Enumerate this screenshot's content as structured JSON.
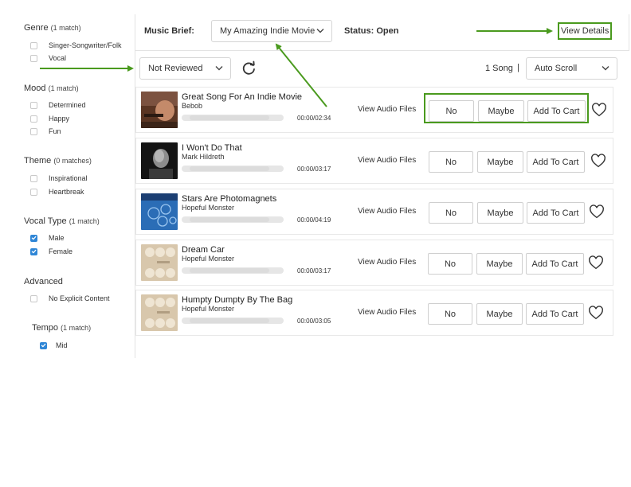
{
  "sidebar": {
    "sections": [
      {
        "title": "Genre",
        "count": "(1 match)",
        "options": [
          {
            "label": "Singer-Songwriter/Folk",
            "checked": false
          },
          {
            "label": "Vocal",
            "checked": false
          }
        ]
      },
      {
        "title": "Mood",
        "count": "(1 match)",
        "options": [
          {
            "label": "Determined",
            "checked": false
          },
          {
            "label": "Happy",
            "checked": false
          },
          {
            "label": "Fun",
            "checked": false
          }
        ]
      },
      {
        "title": "Theme",
        "count": "(0 matches)",
        "options": [
          {
            "label": "Inspirational",
            "checked": false
          },
          {
            "label": "Heartbreak",
            "checked": false
          }
        ]
      },
      {
        "title": "Vocal Type",
        "count": "(1 match)",
        "options": [
          {
            "label": "Male",
            "checked": true
          },
          {
            "label": "Female",
            "checked": true
          }
        ]
      },
      {
        "title": "Advanced",
        "count": "",
        "options": [
          {
            "label": "No Explicit Content",
            "checked": false
          }
        ]
      },
      {
        "title": "Tempo",
        "count": "(1 match)",
        "options": [
          {
            "label": "Mid",
            "checked": true
          }
        ]
      }
    ]
  },
  "header": {
    "music_brief_label": "Music Brief:",
    "music_brief_value": "My Amazing Indie Movie",
    "status": "Status: Open",
    "view_details": "View Details"
  },
  "toolbar": {
    "filter_value": "Not Reviewed",
    "song_count": "1 Song",
    "separator": "|",
    "scroll_value": "Auto Scroll"
  },
  "songs": [
    {
      "title": "Great Song For An Indie Movie",
      "artist": "Bebob",
      "time": "00:00/02:34"
    },
    {
      "title": "I Won't Do That",
      "artist": "Mark Hildreth",
      "time": "00:00/03:17"
    },
    {
      "title": "Stars Are Photomagnets",
      "artist": "Hopeful Monster",
      "time": "00:00/04:19"
    },
    {
      "title": "Dream Car",
      "artist": "Hopeful Monster",
      "time": "00:00/03:17"
    },
    {
      "title": "Humpty Dumpty By The Bag",
      "artist": "Hopeful Monster",
      "time": "00:00/03:05"
    }
  ],
  "row_actions": {
    "view_audio_files": "View Audio Files",
    "no": "No",
    "maybe": "Maybe",
    "add_to_cart": "Add To Cart"
  },
  "icons": {
    "refresh": "refresh-icon",
    "chevron": "chevron-down-icon",
    "heart": "heart-icon",
    "check": "check-icon"
  },
  "colors": {
    "annotation_green": "#4a9a1e",
    "checkbox_blue": "#2f86d6"
  }
}
